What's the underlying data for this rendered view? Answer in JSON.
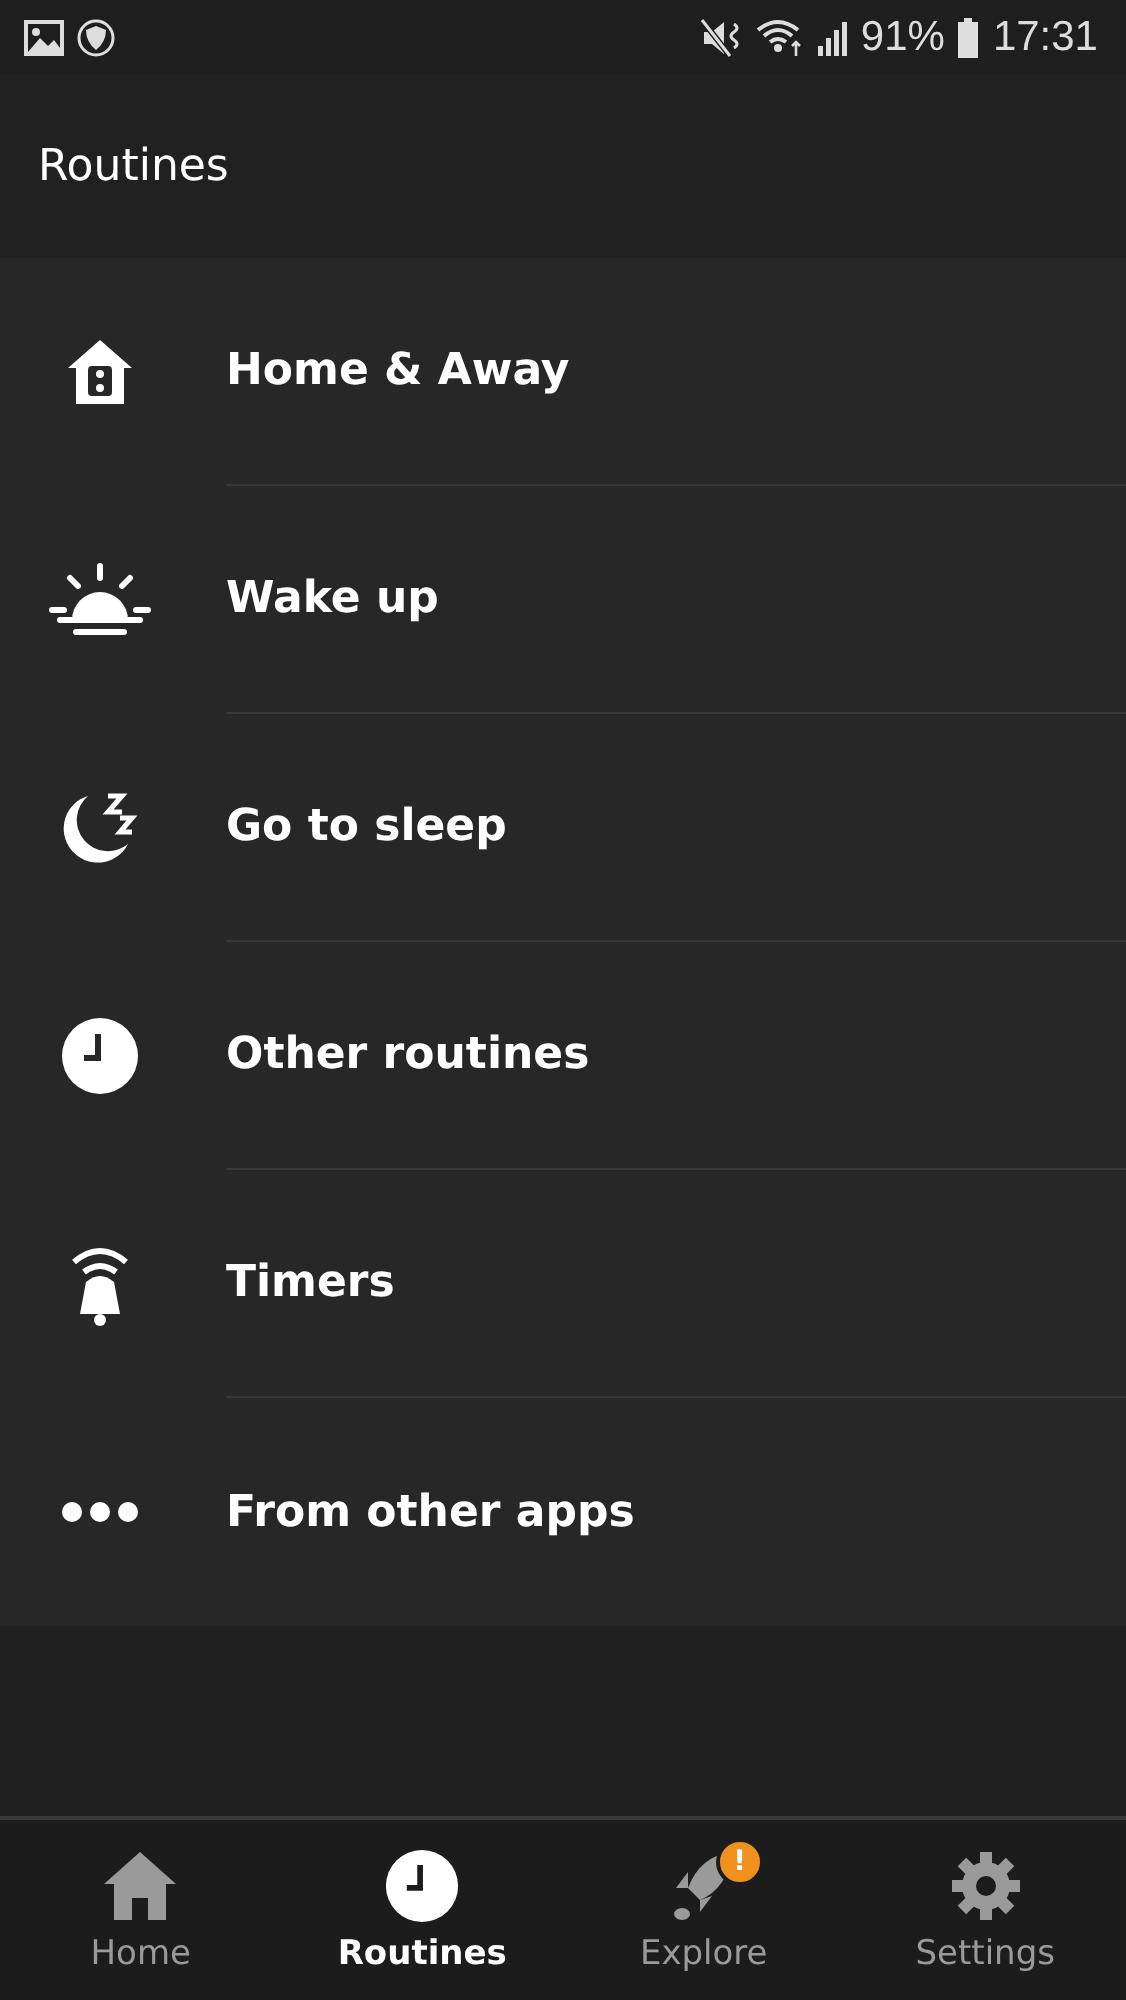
{
  "status_bar": {
    "battery": "91%",
    "time": "17:31"
  },
  "header": {
    "title": "Routines"
  },
  "routines": [
    {
      "kind": "home",
      "label": "Home & Away"
    },
    {
      "kind": "sunrise",
      "label": "Wake up"
    },
    {
      "kind": "sleep",
      "label": "Go to sleep"
    },
    {
      "kind": "clock",
      "label": "Other routines"
    },
    {
      "kind": "bell",
      "label": "Timers"
    },
    {
      "kind": "dots",
      "label": "From other apps"
    }
  ],
  "bottom_nav": [
    {
      "kind": "home",
      "label": "Home",
      "selected": false
    },
    {
      "kind": "clock",
      "label": "Routines",
      "selected": true
    },
    {
      "kind": "rocket",
      "label": "Explore",
      "selected": false,
      "badge": "!"
    },
    {
      "kind": "gear",
      "label": "Settings",
      "selected": false
    }
  ]
}
